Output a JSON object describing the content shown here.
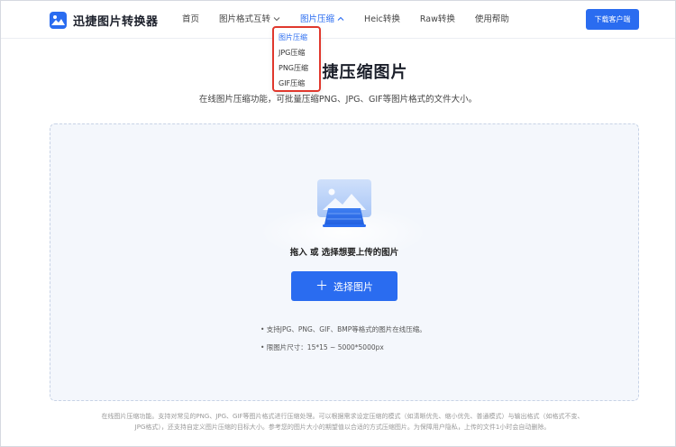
{
  "header": {
    "logo_text": "迅捷图片转换器",
    "nav": [
      {
        "label": "首页"
      },
      {
        "label": "图片格式互转"
      },
      {
        "label": "图片压缩"
      },
      {
        "label": "Heic转换"
      },
      {
        "label": "Raw转换"
      },
      {
        "label": "使用帮助"
      }
    ],
    "download_label": "下载客户端"
  },
  "dropdown": {
    "items": [
      {
        "label": "图片压缩"
      },
      {
        "label": "JPG压缩"
      },
      {
        "label": "PNG压缩"
      },
      {
        "label": "GIF压缩"
      }
    ]
  },
  "main": {
    "title_visible": "捷压缩图片",
    "subtitle": "在线图片压缩功能，可批量压缩PNG、JPG、GIF等图片格式的文件大小。",
    "upload_hint": "拖入 或 选择想要上传的图片",
    "choose_label": "选择图片",
    "bullets": [
      "• 支持JPG、PNG、GIF、BMP等格式的图片在线压缩。",
      "• 限图片尺寸：15*15 ~ 5000*5000px"
    ],
    "footer_line1": "在线图片压缩功能。支持对常见的PNG、JPG、GIF等图片格式进行压缩处理。可以根据需求设定压缩的模式（如清晰优先、缩小优先、普通模式）与输出格式（如格式不变、",
    "footer_line2": "JPG格式），还支持自定义图片压缩的目标大小。参考您的图片大小的期望值以合适的方式压缩图片。为保障用户隐私，上传的文件1小时会自动删除。"
  },
  "colors": {
    "accent": "#2a6cf0",
    "highlight_border": "#e0382d"
  },
  "icons": [
    "logo-icon",
    "chevron-down-icon",
    "chevron-up-icon",
    "image-upload-icon",
    "plus-icon"
  ]
}
